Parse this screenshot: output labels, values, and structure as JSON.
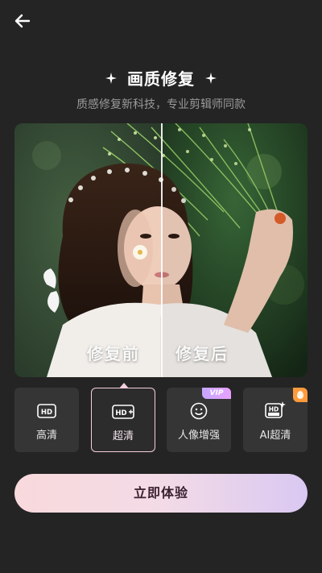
{
  "header": {
    "back_icon": "arrow-left-icon"
  },
  "hero": {
    "title": "画质修复",
    "subtitle": "质感修复新科技，专业剪辑师同款"
  },
  "preview": {
    "before_label": "修复前",
    "after_label": "修复后"
  },
  "modes": [
    {
      "label": "高清",
      "icon": "hd-icon",
      "active": false,
      "badge": ""
    },
    {
      "label": "超清",
      "icon": "hd-plus-icon",
      "active": true,
      "badge": ""
    },
    {
      "label": "人像增强",
      "icon": "smile-face-icon",
      "active": false,
      "badge": "VIP"
    },
    {
      "label": "AI超清",
      "icon": "hd-ultra-sparkle-icon",
      "active": false,
      "badge": ""
    }
  ],
  "cta": {
    "label": "立即体验"
  },
  "colors": {
    "background": "#242424",
    "active_border": "#f4cede",
    "cta_gradient_start": "#f8d9dc",
    "cta_gradient_end": "#d9c8f2",
    "vip_badge": "#d8a3ff",
    "orange_badge": "#ff9a3c"
  }
}
